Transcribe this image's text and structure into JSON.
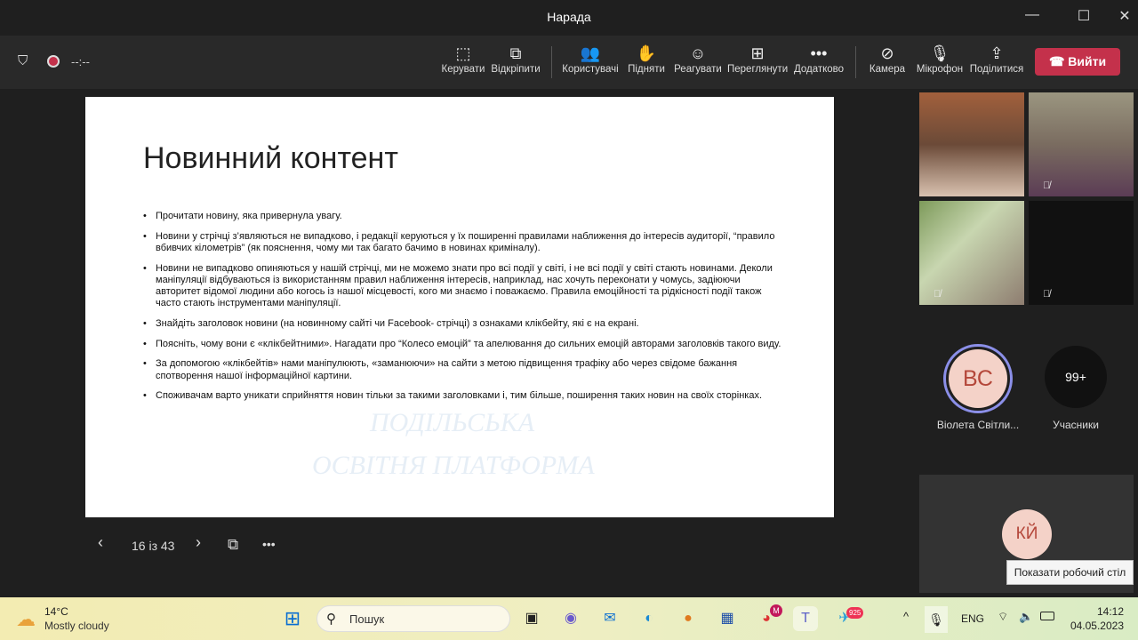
{
  "window": {
    "title": "Нарада"
  },
  "toolbar": {
    "timer": "--:--",
    "buttons": [
      {
        "label": "Керувати",
        "icon": "control-icon"
      },
      {
        "label": "Відкріпити",
        "icon": "popout-icon"
      },
      {
        "label": "Користувачі",
        "icon": "people-icon"
      },
      {
        "label": "Підняти",
        "icon": "hand-icon"
      },
      {
        "label": "Реагувати",
        "icon": "smiley-icon"
      },
      {
        "label": "Переглянути",
        "icon": "view-icon"
      },
      {
        "label": "Додатково",
        "icon": "more-icon"
      },
      {
        "label": "Камера",
        "icon": "camera-off-icon"
      },
      {
        "label": "Мікрофон",
        "icon": "mic-off-icon"
      },
      {
        "label": "Поділитися",
        "icon": "share-icon"
      }
    ],
    "leave": "Вийти"
  },
  "slide": {
    "title": "Новинний контент",
    "bullets": [
      "Прочитати новину, яка привернула увагу.",
      "Новини у стрічці з’являються не випадково, і редакції керуються у їх поширенні правилами наближення до інтересів аудиторії, “правило вбивчих кілометрів” (як пояснення, чому ми так багато бачимо в новинах криміналу).",
      "Новини не випадково опиняються у нашій стрічці, ми не можемо знати про всі події у світі, і не всі події у світі стають новинами. Деколи маніпуляції відбуваються із використанням правил наближення інтересів, наприклад, нас хочуть переконати у чомусь, задіюючи авторитет відомої людини або когось із нашої місцевості, кого ми знаємо і поважаємо. Правила емоційності та рідкісності події також часто стають інструментами маніпуляції.",
      "Знайдіть заголовок новини (на новинному сайті чи Facebook- стрічці) з ознаками клікбейту, які є на екрані.",
      "Поясніть, чому вони є «клікбейтними». Нагадати про “Колесо емоцій” та апелювання до сильних емоцій авторами заголовків такого виду.",
      "За допомогою «клікбейтів» нами маніпулюють, «заманюючи» на сайти з метою підвищення трафіку або через свідоме бажання спотворення нашої інформаційної картини.",
      "Споживачам варто уникати сприйняття новин тільки за такими заголовками і, тим більше, поширення таких новин на своїх сторінках."
    ],
    "watermark": [
      "ПОДІЛЬСЬКА",
      "ОСВІТНЯ ПЛАТФОРМА"
    ]
  },
  "slide_nav": {
    "counter": "16 із 43"
  },
  "participants": {
    "bc_initials": "ВС",
    "bc_name": "Віолета Світли...",
    "more_count": "99+",
    "more_label": "Учасники",
    "ky_initials": "КЙ",
    "tooltip": "Показати робочий стіл"
  },
  "taskbar": {
    "temp": "14°C",
    "weather": "Mostly cloudy",
    "search": "Пошук",
    "lang": "ENG",
    "time": "14:12",
    "date": "04.05.2023",
    "chrome_badge": "M",
    "telegram_badge": "925"
  }
}
